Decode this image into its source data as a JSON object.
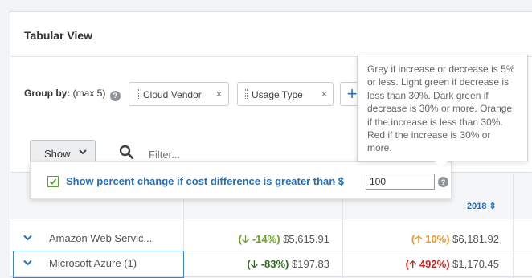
{
  "panel": {
    "title": "Tabular View"
  },
  "groupby": {
    "label": "Group by:",
    "hint": " (max 5)",
    "help_glyph": "?",
    "chips": [
      {
        "label": "Cloud Vendor"
      },
      {
        "label": "Usage Type"
      }
    ],
    "remove_glyph": "×",
    "add_glyph": "+"
  },
  "toolbar": {
    "show_label": "Show",
    "filter_placeholder": "Filter..."
  },
  "table": {
    "year_header": "2018 ⇕",
    "rows": [
      {
        "vendor": "Amazon Web Servic...",
        "col1_pct": "(🡣 -14%)",
        "col1_value": "$5,615.91",
        "col2_pct": "(🡡 10%)",
        "col2_value": "$6,181.92"
      },
      {
        "vendor": "Microsoft Azure (1)",
        "col1_pct": "(🡣 -83%)",
        "col1_value": "$197.83",
        "col2_pct": "(🡡 492%)",
        "col2_value": "$1,170.45"
      }
    ]
  },
  "popover": {
    "label": "Show percent change if cost difference is greater than $",
    "threshold": "100",
    "checked": true
  },
  "tooltip": {
    "text": "Grey if increase or decrease is 5% or less. Light green if decrease is less than 30%. Dark green if decrease is 30% or more. Orange if the increase is less than 30%. Red if the increase is 30% or more."
  },
  "colors": {
    "accent": "#1f6fc4",
    "light_green": "#6aa321",
    "dark_green": "#2e6b1c",
    "orange": "#f0961e",
    "red": "#c8221f"
  },
  "icons": [
    "help-icon",
    "grip-icon",
    "close-icon",
    "plus-icon",
    "chevron-down-icon",
    "search-icon",
    "check-icon"
  ]
}
